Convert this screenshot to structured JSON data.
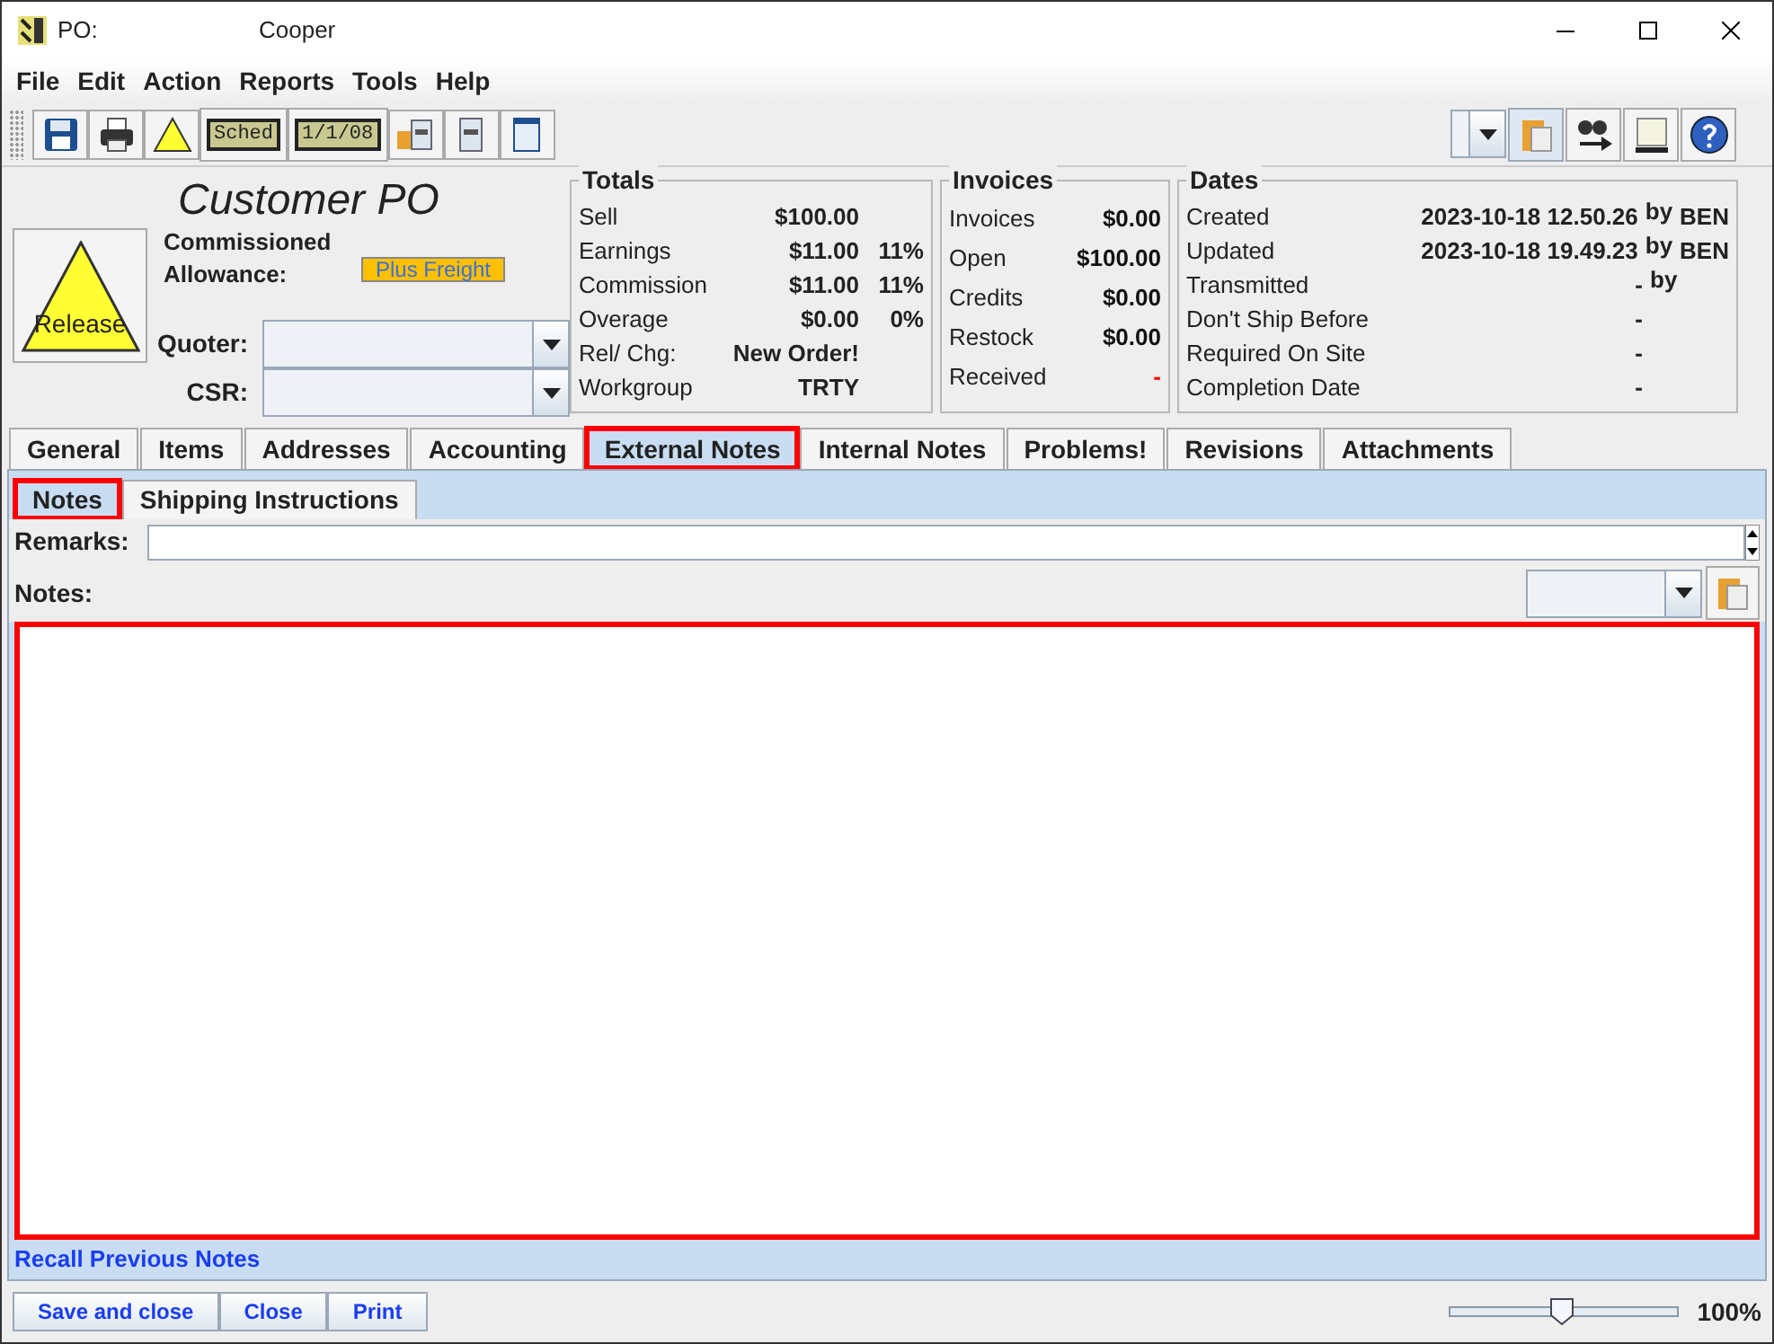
{
  "window": {
    "label": "PO:",
    "title": "Cooper"
  },
  "menu": [
    "File",
    "Edit",
    "Action",
    "Reports",
    "Tools",
    "Help"
  ],
  "toolbar": [
    {
      "kind": "save"
    },
    {
      "kind": "printer"
    },
    {
      "kind": "warning"
    },
    {
      "kind": "text",
      "label": "Sched"
    },
    {
      "kind": "text",
      "label": "1/1/08"
    },
    {
      "kind": "box"
    },
    {
      "kind": "document"
    },
    {
      "kind": "page"
    }
  ],
  "toolbar_right": [
    {
      "kind": "combo"
    },
    {
      "kind": "clipboard"
    },
    {
      "kind": "binoculars"
    },
    {
      "kind": "panel"
    },
    {
      "kind": "help"
    }
  ],
  "header": {
    "title": "Customer PO",
    "release": "Release",
    "allowance_label": "Commissioned Allowance:",
    "allowance_badge": "Plus Freight",
    "quoter_label": "Quoter:",
    "csr_label": "CSR:"
  },
  "totals": {
    "title": "Totals",
    "rows": [
      {
        "label": "Sell",
        "value": "$100.00"
      },
      {
        "label": "Earnings",
        "value": "$11.00",
        "pct": "11%"
      },
      {
        "label": "Commission",
        "value": "$11.00",
        "pct": "11%"
      },
      {
        "label": "Overage",
        "value": "$0.00",
        "pct": "0%"
      },
      {
        "label": "Rel/ Chg:",
        "value": "New Order!"
      },
      {
        "label": "Workgroup",
        "value": "TRTY"
      }
    ]
  },
  "invoices": {
    "title": "Invoices",
    "rows": [
      {
        "label": "Invoices",
        "value": "$0.00",
        "flagged": false
      },
      {
        "label": "Open",
        "value": "$100.00",
        "flagged": false
      },
      {
        "label": "Credits",
        "value": "$0.00",
        "flagged": false
      },
      {
        "label": "Restock",
        "value": "$0.00",
        "flagged": false
      },
      {
        "label": "Received",
        "value": "-",
        "flagged": true
      }
    ]
  },
  "dates": {
    "title": "Dates",
    "rows": [
      {
        "label": "Created",
        "value": "2023-10-18 12.50.26",
        "by": "by",
        "user": "BEN"
      },
      {
        "label": "Updated",
        "value": "2023-10-18 19.49.23",
        "by": "by",
        "user": "BEN"
      },
      {
        "label": "Transmitted",
        "value": "-",
        "by": "by"
      },
      {
        "label": "Don't Ship Before",
        "value": "-"
      },
      {
        "label": "Required On Site",
        "value": "-"
      },
      {
        "label": "Completion Date",
        "value": "-"
      }
    ]
  },
  "tabs": [
    {
      "label": "General",
      "selected": false,
      "highlighted": false
    },
    {
      "label": "Items",
      "selected": false,
      "highlighted": false
    },
    {
      "label": "Addresses",
      "selected": false,
      "highlighted": false
    },
    {
      "label": "Accounting",
      "selected": false,
      "highlighted": false
    },
    {
      "label": "External Notes",
      "selected": true,
      "highlighted": true
    },
    {
      "label": "Internal Notes",
      "selected": false,
      "highlighted": false
    },
    {
      "label": "Problems!",
      "selected": false,
      "highlighted": false
    },
    {
      "label": "Revisions",
      "selected": false,
      "highlighted": false
    },
    {
      "label": "Attachments",
      "selected": false,
      "highlighted": false
    }
  ],
  "subtabs": [
    {
      "label": "Notes",
      "selected": true,
      "highlighted": true
    },
    {
      "label": "Shipping Instructions",
      "selected": false,
      "highlighted": false
    }
  ],
  "remarks_label": "Remarks:",
  "notes_label": "Notes:",
  "notes_area": {
    "highlighted": true
  },
  "recall_link": "Recall Previous Notes",
  "buttons": [
    "Save and close",
    "Close",
    "Print"
  ],
  "zoom": {
    "level": 0.49,
    "reading": "100%"
  }
}
